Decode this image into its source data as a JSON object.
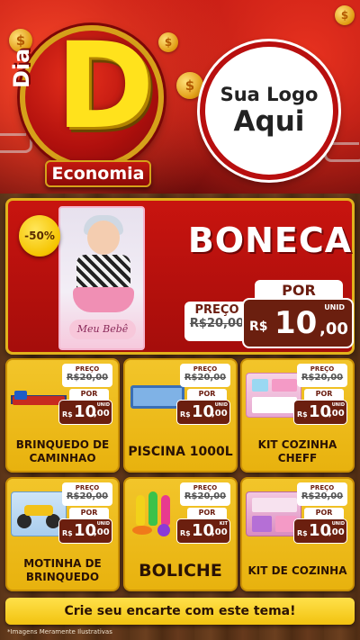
{
  "header": {
    "logo": {
      "dia": "Dia",
      "letter": "D",
      "economia": "Economia"
    },
    "brand_placeholder": {
      "line1": "Sua Logo",
      "line2": "Aqui"
    }
  },
  "featured": {
    "discount": "-50%",
    "name": "BONECA",
    "box_label": "Meu Bebê",
    "old_price_label": "PREÇO",
    "old_price": "R$20,00",
    "new_price_label": "POR",
    "currency": "R$",
    "price_int": "10",
    "price_dec": ",00",
    "unit": "UNID"
  },
  "products": [
    {
      "name": "BRINQUEDO DE CAMINHAO",
      "old_label": "PREÇO",
      "old_price": "R$20,00",
      "por": "POR",
      "currency": "R$",
      "price_int": "10",
      "price_dec": ",00",
      "unit": "UNID"
    },
    {
      "name": "PISCINA 1000L",
      "old_label": "PREÇO",
      "old_price": "R$20,00",
      "por": "POR",
      "currency": "R$",
      "price_int": "10",
      "price_dec": ",00",
      "unit": "UNID"
    },
    {
      "name": "KIT COZINHA CHEFF",
      "old_label": "PREÇO",
      "old_price": "R$20,00",
      "por": "POR",
      "currency": "R$",
      "price_int": "10",
      "price_dec": ",00",
      "unit": "UNID"
    },
    {
      "name": "MOTINHA DE BRINQUEDO",
      "old_label": "PREÇO",
      "old_price": "R$20,00",
      "por": "POR",
      "currency": "R$",
      "price_int": "10",
      "price_dec": ",00",
      "unit": "UNID"
    },
    {
      "name": "BOLICHE",
      "old_label": "PREÇO",
      "old_price": "R$20,00",
      "por": "POR",
      "currency": "R$",
      "price_int": "10",
      "price_dec": ",00",
      "unit": "KIT"
    },
    {
      "name": "KIT DE COZINHA",
      "old_label": "PREÇO",
      "old_price": "R$20,00",
      "por": "POR",
      "currency": "R$",
      "price_int": "10",
      "price_dec": ",00",
      "unit": "UNID"
    }
  ],
  "footer": {
    "cta": "Crie seu encarte com este tema!",
    "disclaimer": "*Imagens Meramente Ilustrativas"
  },
  "colors": {
    "header_red": "#b3100f",
    "card_yellow": "#f2c52a",
    "price_brown": "#6b1f0f",
    "logo_yellow": "#ffe21c"
  }
}
